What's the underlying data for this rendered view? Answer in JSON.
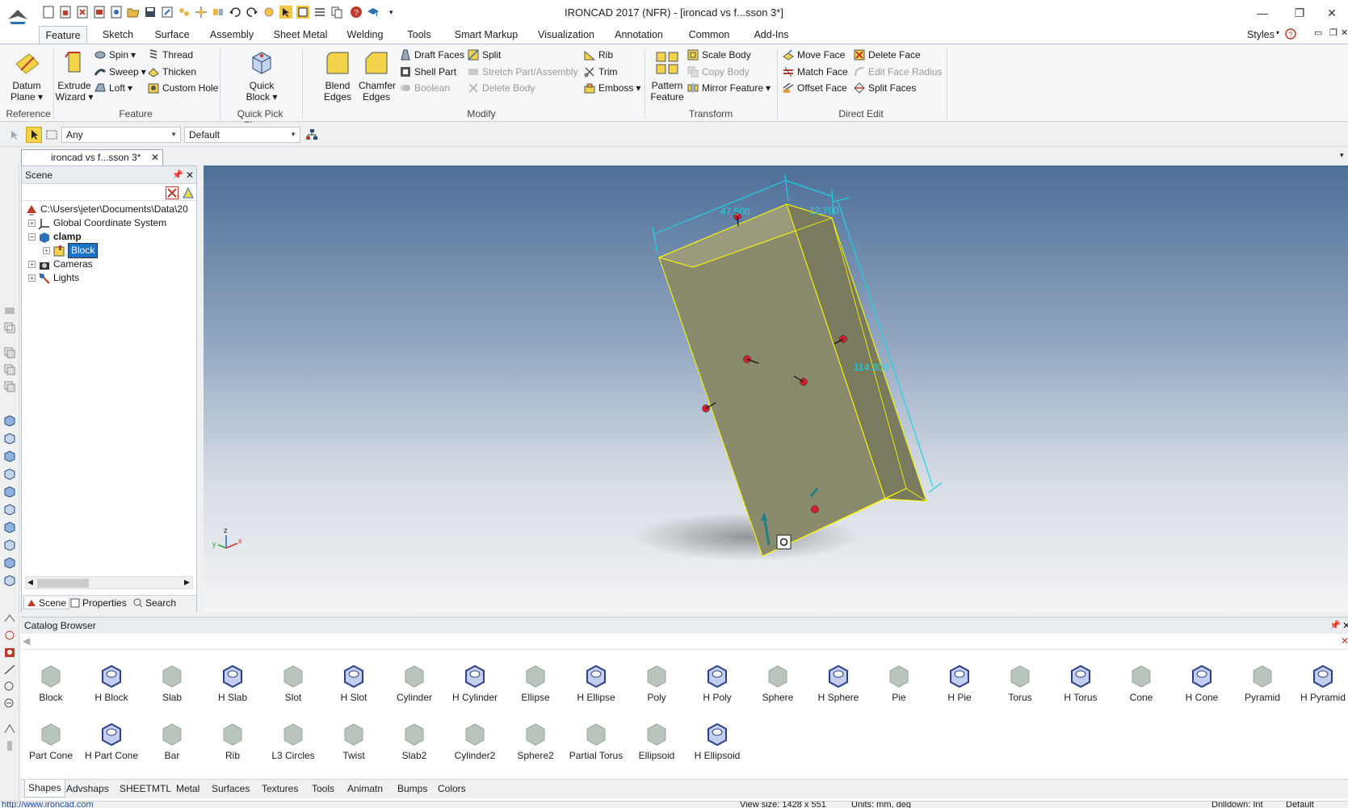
{
  "app_title": "IRONCAD 2017 (NFR) - [ironcad vs f...sson 3*]",
  "styles_label": "Styles",
  "tabs": [
    "Feature",
    "Sketch",
    "Surface",
    "Assembly",
    "Sheet Metal",
    "Welding",
    "Tools",
    "Smart Markup",
    "Visualization",
    "Annotation",
    "Common",
    "Add-Ins"
  ],
  "ribbon": {
    "reference": {
      "datum_plane": "Datum Plane",
      "group": "Reference"
    },
    "feature": {
      "extrude_wizard": "Extrude Wizard",
      "spin": "Spin",
      "sweep": "Sweep",
      "loft": "Loft",
      "thread": "Thread",
      "thicken": "Thicken",
      "custom_hole": "Custom Hole",
      "group": "Feature"
    },
    "quick_pick": {
      "quick_block": "Quick Block",
      "group": "Quick Pick Shapes"
    },
    "modify": {
      "blend_edges": "Blend Edges",
      "chamfer_edges": "Chamfer Edges",
      "draft_faces": "Draft Faces",
      "shell_part": "Shell Part",
      "boolean": "Boolean",
      "split": "Split",
      "stretch_part": "Stretch Part/Assembly",
      "delete_body": "Delete Body",
      "rib": "Rib",
      "trim": "Trim",
      "emboss": "Emboss",
      "group": "Modify"
    },
    "transform": {
      "pattern_feature": "Pattern Feature",
      "scale_body": "Scale Body",
      "copy_body": "Copy Body",
      "mirror_feature": "Mirror Feature",
      "group": "Transform"
    },
    "direct_edit": {
      "move_face": "Move Face",
      "match_face": "Match Face",
      "offset_face": "Offset Face",
      "delete_face": "Delete Face",
      "edit_face_radius": "Edit Face Radius",
      "split_faces": "Split Faces",
      "group": "Direct Edit"
    }
  },
  "selection": {
    "filter": "Any",
    "style": "Default"
  },
  "document_tab": "ironcad vs f...sson 3*",
  "scene": {
    "title": "Scene",
    "path": "C:\\Users\\jeter\\Documents\\Data\\20",
    "items": [
      "Global Coordinate System",
      "clamp",
      "Block",
      "Cameras",
      "Lights"
    ],
    "tabs": [
      "Scene",
      "Properties",
      "Search"
    ]
  },
  "viewport": {
    "dim_width": "47.500",
    "dim_depth": "12.700",
    "dim_length": "114.300",
    "axes": {
      "z": "z",
      "x": "x",
      "y": "y"
    }
  },
  "catalog": {
    "title": "Catalog Browser",
    "row1": [
      "Block",
      "H Block",
      "Slab",
      "H Slab",
      "Slot",
      "H Slot",
      "Cylinder",
      "H Cylinder",
      "Ellipse",
      "H Ellipse",
      "Poly",
      "H Poly",
      "Sphere",
      "H Sphere",
      "Pie",
      "H Pie",
      "Torus",
      "H Torus",
      "Cone",
      "H Cone",
      "Pyramid",
      "H Pyramid"
    ],
    "row2": [
      "Part Cone",
      "H Part Cone",
      "Bar",
      "Rib",
      "L3 Circles",
      "Twist",
      "Slab2",
      "Cylinder2",
      "Sphere2",
      "Partial Torus",
      "Ellipsoid",
      "H Ellipsoid"
    ],
    "tabs": [
      "Shapes",
      "Advshaps",
      "SHEETMTL",
      "Metal",
      "Surfaces",
      "Textures",
      "Tools",
      "Animatn",
      "Bumps",
      "Colors"
    ]
  },
  "status": {
    "url": "http://www.ironcad.com",
    "view_size": "View size: 1428 x 551",
    "units": "Units: mm, deg",
    "drilldown": "Drilldown: Int",
    "default": "Default"
  },
  "colors": {
    "accent": "#1e6fc6",
    "part_fill": "#8a8a6c",
    "dimension": "#1fd2e6"
  }
}
